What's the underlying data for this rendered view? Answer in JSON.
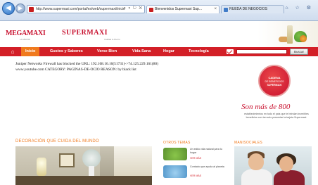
{
  "browser": {
    "address_url": "http://www.supermaxi.com/portal/es/web/supermaxi/inicio",
    "address_controls": "⌕ ▾ ↻ ✕",
    "tabs": [
      {
        "label": "Bienvenidos Supermaxi Sup...",
        "close": "×"
      },
      {
        "label": "RUEDA DE NEGOCIOS",
        "close": ""
      }
    ],
    "window_controls": "⌂ ☆ ⚙"
  },
  "header": {
    "logo_megamaxi": "MEGAMAXI",
    "logo_megamaxi_sub": "LA MEJOR",
    "logo_supermaxi": "SUPERMAXI",
    "logo_supermaxi_sub": "Calidad & Ahorro"
  },
  "nav": {
    "home_icon": "⌂",
    "items": [
      {
        "label": "Inicio"
      },
      {
        "label": "Gustos y Sabores"
      },
      {
        "label": "Verse Bien"
      },
      {
        "label": "Vida Sana"
      },
      {
        "label": "Hogar"
      },
      {
        "label": "Tecnología"
      }
    ],
    "search_placeholder": "",
    "search_button": "Buscar"
  },
  "blocked": {
    "line1": "Juniper Networks Firewall has blocked the URL: 192.168.16.16(51731)->74.125.229.161(80)",
    "line2": "www.youtube.com CATEGORY: PAGINAS-DE-OCIO REASON: by black list"
  },
  "promo": {
    "badge_line1": "CADENA",
    "badge_line2": "DE BENEFICIOS",
    "badge_line3": "SUPERMAXI",
    "title": "Son más de 800",
    "text": "establecimientos en todo el país que te brindan increíbles beneficios con tan solo presentar la tarjeta Supermaxi."
  },
  "sections": {
    "decor_title": "DECORACIÓN QUE CUIDA DEL MUNDO",
    "otros_title": "OTROS TEMAS",
    "otros_items": [
      {
        "text": "Un estilo vida natural para tu hogar",
        "more": "VER MÁS"
      },
      {
        "text": "Contacto que ayuda al planeta",
        "more": "VER MÁS"
      }
    ],
    "mani_title": "MANISOCIALES"
  },
  "colors": {
    "brand_red": "#d31f27",
    "accent_orange": "#f07a1e"
  }
}
